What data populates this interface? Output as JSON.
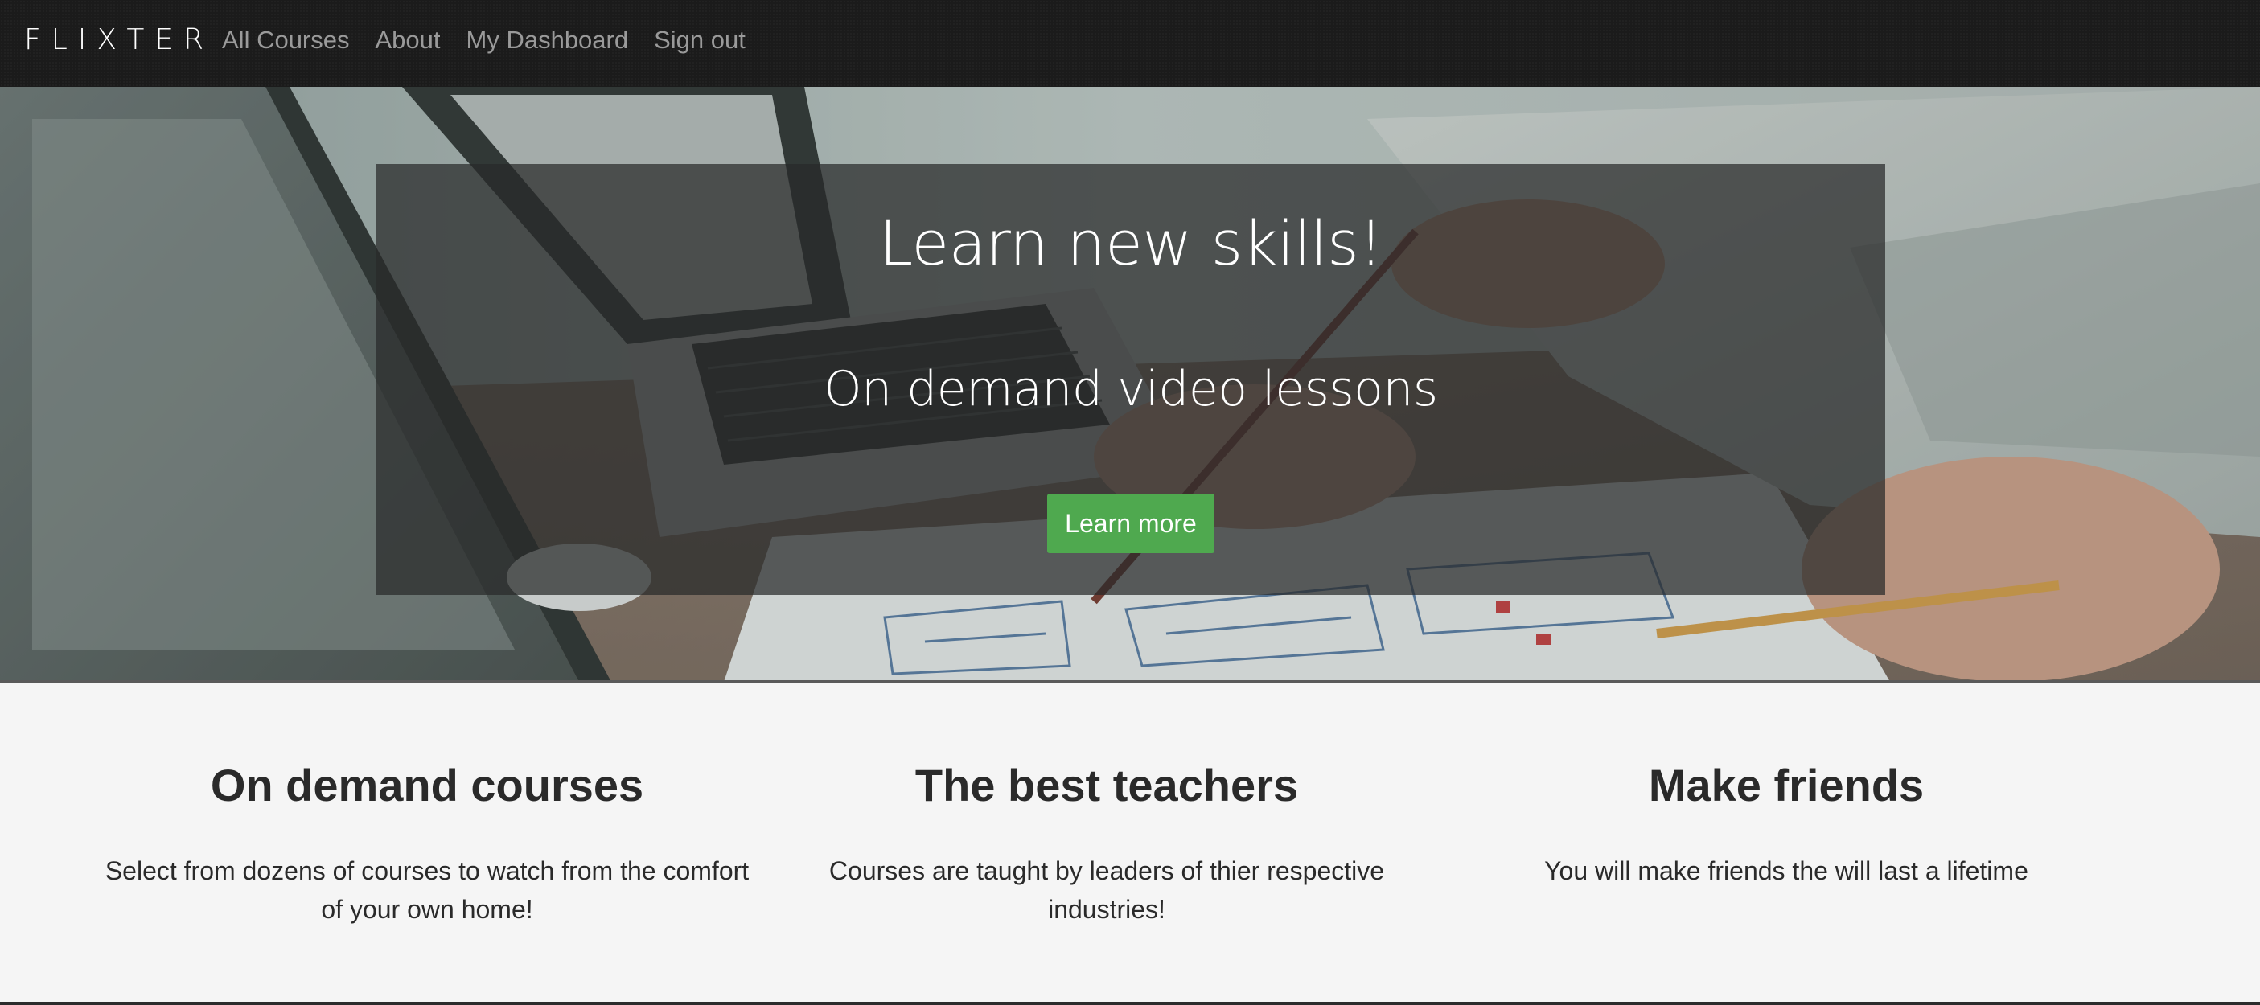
{
  "navbar": {
    "brand": "FLIXTER",
    "links": [
      {
        "label": "All Courses"
      },
      {
        "label": "About"
      },
      {
        "label": "My Dashboard"
      },
      {
        "label": "Sign out"
      }
    ]
  },
  "hero": {
    "title": "Learn new skills!",
    "subtitle": "On demand video lessons",
    "button_label": "Learn more"
  },
  "features": [
    {
      "title": "On demand courses",
      "text": "Select from dozens of courses to watch from the comfort of your own home!"
    },
    {
      "title": "The best teachers",
      "text": "Courses are taught by leaders of thier respective industries!"
    },
    {
      "title": "Make friends",
      "text": "You will make friends the will last a lifetime"
    }
  ],
  "colors": {
    "navbar_bg": "#1b1b1b",
    "nav_link": "#9a9a9a",
    "button_green": "#4fa94f",
    "page_bg": "#f5f5f5",
    "text_dark": "#2a2a2a"
  }
}
